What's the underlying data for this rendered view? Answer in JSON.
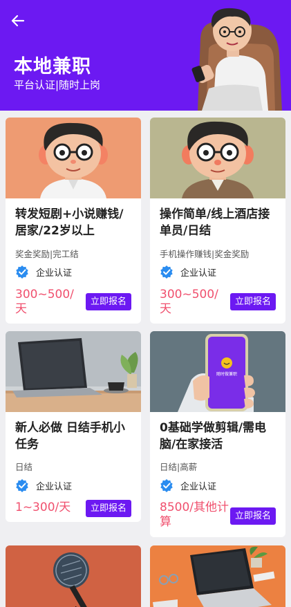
{
  "header": {
    "title": "本地兼职",
    "subtitle": "平台认证|随时上岗",
    "back_icon": "arrow-left-icon"
  },
  "colors": {
    "accent": "#6c19f2",
    "price": "#f0506e",
    "verify": "#2a8cf0"
  },
  "jobs": [
    {
      "title": "转发短剧+小说赚钱/居家/22岁以上",
      "tags": "奖金奖励|完工结",
      "verify_label": "企业认证",
      "price": "300~500/天",
      "apply_label": "立即报名"
    },
    {
      "title": "操作简单/线上酒店接单员/日结",
      "tags": "手机操作赚钱|奖金奖励",
      "verify_label": "企业认证",
      "price": "300~500/天",
      "apply_label": "立即报名"
    },
    {
      "title": "新人必做 日结手机小任务",
      "tags": "日结",
      "verify_label": "企业认证",
      "price": "1~300/天",
      "apply_label": "立即报名"
    },
    {
      "title": "0基础学做剪辑/需电脑/在家接活",
      "tags": "日结|高薪",
      "verify_label": "企业认证",
      "price": "8500/其他计算",
      "apply_label": "立即报名"
    }
  ],
  "phone_screen_text": "随时做兼职"
}
